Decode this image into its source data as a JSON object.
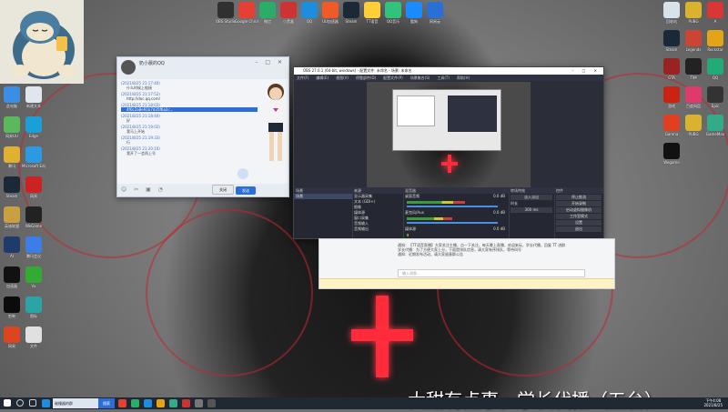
{
  "desktop": {
    "top_icons": [
      {
        "label": "OBS Studio",
        "icon": "obs-icon",
        "color": "#303030"
      },
      {
        "label": "Google Chrome",
        "icon": "chrome-icon",
        "color": "#e44134"
      },
      {
        "label": "微信",
        "icon": "wechat-icon",
        "color": "#2aae67"
      },
      {
        "label": "小黑盒",
        "icon": "heybox-icon",
        "color": "#c33"
      },
      {
        "label": "QQ",
        "icon": "qq-icon",
        "color": "#1e8de0"
      },
      {
        "label": "UU加速器",
        "icon": "uu-icon",
        "color": "#f05a28"
      },
      {
        "label": "Steam",
        "icon": "steam-icon",
        "color": "#1b2838"
      },
      {
        "label": "TT语音",
        "icon": "tt-icon",
        "color": "#ffcf3a"
      },
      {
        "label": "QQ音乐",
        "icon": "qqmusic-icon",
        "color": "#31c27c"
      },
      {
        "label": "酷狗",
        "icon": "kugou-icon",
        "color": "#1a8cff"
      },
      {
        "label": "网易云",
        "icon": "netease-icon",
        "color": "#2a6fd6"
      }
    ],
    "left_icons": [
      {
        "label": "此电脑",
        "icon": "computer-icon",
        "color": "#3a8ee6"
      },
      {
        "label": "新建文本",
        "icon": "file-icon",
        "color": "#dfe6ee"
      },
      {
        "label": "网易UU",
        "icon": "uu2-icon",
        "color": "#5cb85c"
      },
      {
        "label": "Edge",
        "icon": "edge-icon",
        "color": "#1aa0d6"
      },
      {
        "label": "腾讯",
        "icon": "tencent-icon",
        "color": "#e0b030"
      },
      {
        "label": "Microsoft Edge",
        "icon": "edge2-icon",
        "color": "#2b9ae0"
      },
      {
        "label": "Steam",
        "icon": "steam2-icon",
        "color": "#1b2838"
      },
      {
        "label": "网易",
        "icon": "wy-icon",
        "color": "#c22"
      },
      {
        "label": "英雄联盟",
        "icon": "lol-icon",
        "color": "#c8a040"
      },
      {
        "label": "WeGame",
        "icon": "wegame-icon",
        "color": "#222"
      },
      {
        "label": "AI",
        "icon": "ai-icon",
        "color": "#1f3b6b"
      },
      {
        "label": "腾讯会议",
        "icon": "meeting-icon",
        "color": "#3d7de8"
      },
      {
        "label": "加速器",
        "icon": "acc-icon",
        "color": "#111"
      },
      {
        "label": "Vx",
        "icon": "vx-icon",
        "color": "#3a3"
      },
      {
        "label": "剪映",
        "icon": "jianying-icon",
        "color": "#0b0b0b"
      },
      {
        "label": "图标",
        "icon": "icon2-icon",
        "color": "#2aa4a4"
      },
      {
        "label": "网易",
        "icon": "wy2-icon",
        "color": "#d42"
      },
      {
        "label": "文件",
        "icon": "file2-icon",
        "color": "#e0e0e0"
      }
    ],
    "right_icons": [
      {
        "label": "回收站",
        "icon": "recycle-icon",
        "color": "#d8e2ea"
      },
      {
        "label": "PUBG",
        "icon": "pubg-icon",
        "color": "#d9b32e"
      },
      {
        "label": "A",
        "icon": "a-icon",
        "color": "#d93636"
      },
      {
        "label": "Steam",
        "icon": "steam3-icon",
        "color": "#1b2838"
      },
      {
        "label": "Legends",
        "icon": "legend-icon",
        "color": "#c43"
      },
      {
        "label": "Rockstar",
        "icon": "rockstar-icon",
        "color": "#e3a417"
      },
      {
        "label": "GTA",
        "icon": "gta-icon",
        "color": "#922"
      },
      {
        "label": "TIM",
        "icon": "tim-icon",
        "color": "#222"
      },
      {
        "label": "QQ",
        "icon": "qq2-icon",
        "color": "#2a7"
      },
      {
        "label": "游戏",
        "icon": "game-icon",
        "color": "#c21"
      },
      {
        "label": "百度网盘",
        "icon": "baidu-icon",
        "color": "#e03a6a"
      },
      {
        "label": "Epic",
        "icon": "epic-icon",
        "color": "#333"
      },
      {
        "label": "Garena",
        "icon": "garena-icon",
        "color": "#e04020"
      },
      {
        "label": "PUBG",
        "icon": "pubg2-icon",
        "color": "#d9b32e"
      },
      {
        "label": "GameMax",
        "icon": "gmax-icon",
        "color": "#3a8"
      },
      {
        "label": "Wegame",
        "icon": "wg2-icon",
        "color": "#111"
      }
    ]
  },
  "chat_window": {
    "title": "奶小晨的QQ",
    "messages": [
      {
        "meta": "(2021/8/25 21:17:40)",
        "text": "什么时候上链接"
      },
      {
        "meta": "(2021/8/25 21:17:52)",
        "text": "http://doc.qq.com/"
      },
      {
        "meta": "(2021/8/25 21:18:03)",
        "text": "4f0c2a8e91b7d35f6a2c...",
        "selected": true
      },
      {
        "meta": "(2021/8/25 21:18:40)",
        "text": "好"
      },
      {
        "meta": "(2021/8/25 21:19:02)",
        "text": "我马上开始"
      },
      {
        "meta": "(2021/8/25 21:19:33)",
        "text": "行"
      },
      {
        "meta": "(2021/8/25 21:20:10)",
        "text": "我开了一会再上号"
      }
    ],
    "close_label": "关闭",
    "send_label": "发送"
  },
  "obs": {
    "title": "OBS 27.0.1 (64-bit, windows) - 配置文件: 未命名 - 场景: 未命名",
    "menu": [
      "文件(F)",
      "编辑(E)",
      "视图(V)",
      "停靠部件(D)",
      "配置文件(P)",
      "场景集合(S)",
      "工具(T)",
      "帮助(H)"
    ],
    "scenes_header": "场景",
    "scenes": [
      "场景"
    ],
    "sources_header": "来源",
    "sources": [
      "显示器采集",
      "文本 (GDI+)",
      "图像",
      "媒体源",
      "窗口采集",
      "音频输入",
      "音频输出"
    ],
    "mixer_header": "混音器",
    "mixer": [
      {
        "name": "桌面音频",
        "db": "0.0 dB",
        "level": 0.62
      },
      {
        "name": "麦克风/Aux",
        "db": "0.0 dB",
        "level": 0.48
      },
      {
        "name": "媒体源",
        "db": "0.0 dB",
        "level": 0.0
      }
    ],
    "transitions_header": "转场特效",
    "transition_value": "淡入淡出",
    "duration_label": "时长",
    "duration_value": "300 ms",
    "controls_header": "控件",
    "controls": [
      "停止推流",
      "开始录制",
      "启动虚拟摄像机",
      "工作室模式",
      "设置",
      "退出"
    ]
  },
  "group_chat": {
    "lines": [
      "通知：【TT语音直播】大家关注主播，点一下关注，每天晚上直播，欢迎来玩，学长代播，回复 TT 进群",
      "学长代播：为了方便大家上分，下面是排队信息，请大家有序排队，等待叫号",
      "通知：近期发布活动，请大家留意群公告"
    ],
    "placeholder": "输入消息..."
  },
  "caption": "大甜有点事，学长代播（五台）",
  "taskbar": {
    "search_label": "搜索",
    "active_app": "碰撞器的群",
    "time": "下午4:08",
    "date": "2021/8/25"
  }
}
